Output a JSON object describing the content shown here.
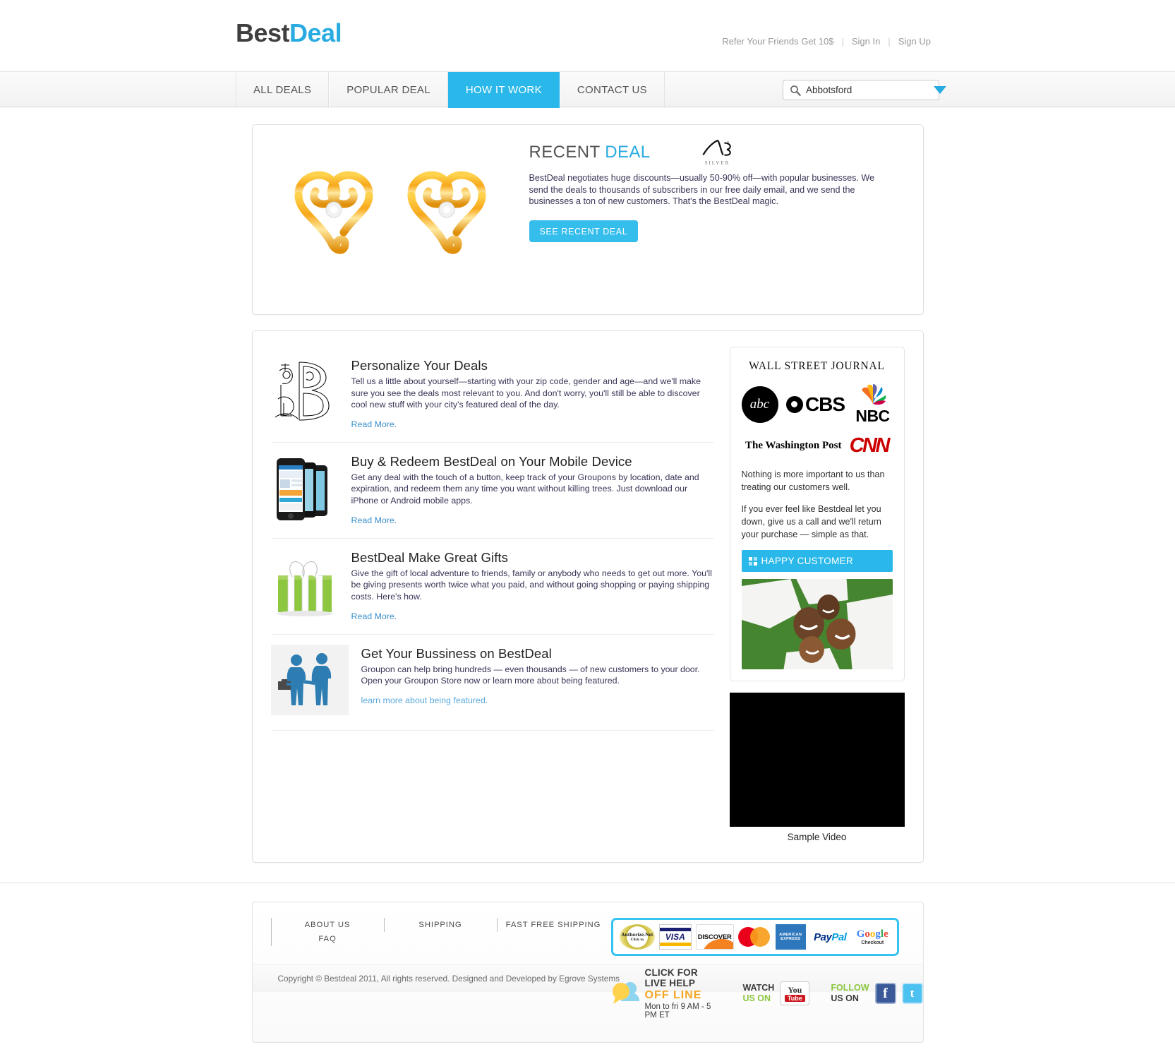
{
  "header": {
    "logo_best": "Best",
    "logo_deal": "Deal",
    "top_links": [
      {
        "label": "Refer Your Friends Get 10$"
      },
      {
        "label": "Sign In"
      },
      {
        "label": "Sign Up"
      }
    ],
    "separator": "|"
  },
  "nav": {
    "items": [
      {
        "label": "ALL DEALS",
        "active": false
      },
      {
        "label": "POPULAR DEAL",
        "active": false
      },
      {
        "label": "HOW IT WORK",
        "active": true
      },
      {
        "label": "CONTACT US",
        "active": false
      }
    ]
  },
  "search": {
    "value": "Abbotsford",
    "placeholder": "Abbotsford",
    "icon": "search-icon",
    "dropdown_icon": "chevron-down-icon"
  },
  "recent_deal": {
    "title_plain": "RECENT",
    "title_highlight": "DEAL",
    "body": "BestDeal negotiates huge discounts—usually 50-90% off—with popular businesses. We send the deals to thousands of subscribers in our free daily email, and we send the businesses a ton of new customers. That's the BestDeal magic.",
    "button_label": "SEE RECENT DEAL",
    "brand_mark_caption": "SILVER",
    "product_image_alt": "gold-heart-earrings"
  },
  "features": [
    {
      "icon": "illuminated-letter-b-icon",
      "title": "Personalize Your Deals",
      "desc": "Tell us a little about yourself—starting with your zip code, gender and age—and we'll make sure you see the deals most relevant to you. And don't worry, you'll still be able to discover cool new stuff with your city's featured deal of the day.",
      "link": "Read More."
    },
    {
      "icon": "mobile-phones-icon",
      "title": "Buy & Redeem BestDeal on Your Mobile Device",
      "desc": "Get any deal with the touch of a button, keep track of your Groupons by location, date and expiration, and redeem them any time you want without killing trees. Just download our iPhone or Android mobile apps.",
      "link": "Read More."
    },
    {
      "icon": "gift-box-icon",
      "title": "BestDeal Make Great Gifts",
      "desc": "Give the gift of local adventure to friends, family or anybody who needs to get out more. You'll be giving presents worth twice what you paid, and without going shopping or paying shipping costs. Here's how.",
      "link": "Read More."
    },
    {
      "icon": "handshake-people-icon",
      "title": "Get Your Bussiness on BestDeal",
      "desc": "Groupon can help bring hundreds — even thousands — of new customers to your door. Open your Groupon Store now or learn more about being featured.",
      "link": "learn more about being featured."
    }
  ],
  "sidebar": {
    "wsj_label": "WALL STREET JOURNAL",
    "logos": [
      {
        "name": "abc-logo",
        "label": "abc"
      },
      {
        "name": "cbs-logo",
        "label": "CBS"
      },
      {
        "name": "nbc-logo",
        "label": "NBC"
      },
      {
        "name": "washington-post-logo",
        "label": "The Washington Post"
      },
      {
        "name": "cnn-logo",
        "label": "CNN"
      }
    ],
    "para1": "Nothing is more important to us than treating our customers well.",
    "para2": "If you ever feel like Bestdeal let you down, give us a call and we'll return your purchase — simple as that.",
    "happy_button": "HAPPY CUSTOMER",
    "happy_photo_alt": "family-lying-on-grass",
    "video_caption": "Sample Video"
  },
  "footer": {
    "links": [
      {
        "label": "ABOUT US"
      },
      {
        "label": "SHIPPING"
      },
      {
        "label": "FAST FREE SHIPPING"
      },
      {
        "label": "FAQ"
      }
    ],
    "payments": [
      {
        "name": "authorize-net-logo",
        "line1": "Authorize.Net",
        "line2": "Click to"
      },
      {
        "name": "visa-logo",
        "label": "VISA"
      },
      {
        "name": "discover-logo",
        "label": "DISCOVER"
      },
      {
        "name": "mastercard-logo",
        "label": "MasterCard"
      },
      {
        "name": "amex-logo",
        "label": "AMERICAN EXPRESS"
      },
      {
        "name": "paypal-logo",
        "label1": "Pay",
        "label2": "Pal"
      },
      {
        "name": "google-checkout-logo",
        "label": "Google",
        "sub": "Checkout"
      }
    ],
    "live_help": {
      "icon": "chat-bubble-icon",
      "line1": "CLICK FOR LIVE HELP",
      "line2": "OFF  LINE",
      "line3": "Mon to fri 9 AM - 5 PM ET"
    },
    "watch": {
      "line1": "WATCH",
      "line2": "US ON",
      "yt1": "You",
      "yt2": "Tube"
    },
    "follow": {
      "line1": "FOLLOW",
      "line2": "US ON",
      "fb": "f",
      "tw": "t"
    },
    "copyright": "Copyright © Bestdeal 2011, All rights reserved. Designed and Developed by Egrove Systems"
  },
  "colors": {
    "accent": "#29abe2",
    "nav_active": "#2ab8ea",
    "button": "#35bdec",
    "link": "#3b8fc9",
    "orange": "#f5a623",
    "green": "#8cc63f"
  }
}
